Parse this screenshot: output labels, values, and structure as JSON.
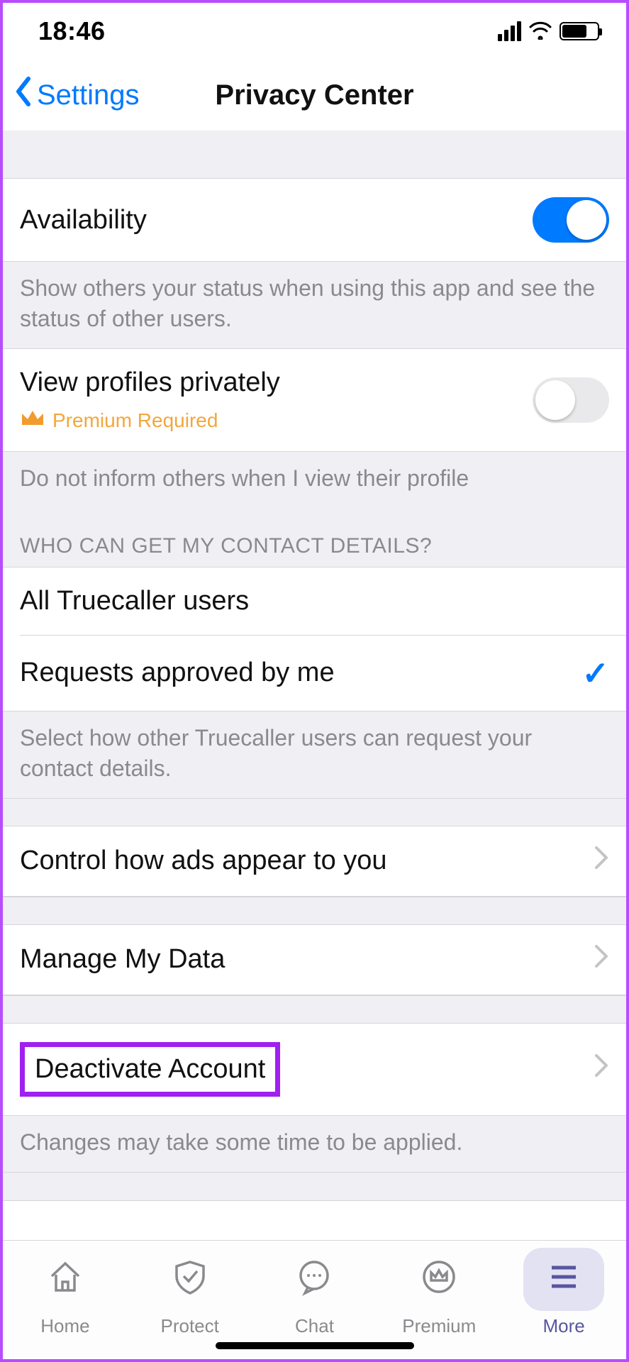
{
  "status": {
    "time": "18:46"
  },
  "nav": {
    "back_label": "Settings",
    "title": "Privacy Center"
  },
  "availability": {
    "label": "Availability",
    "enabled": true,
    "footer": "Show others your status when using this app and see the status of other users."
  },
  "view_privately": {
    "label": "View profiles privately",
    "premium_label": "Premium Required",
    "enabled": false,
    "footer": "Do not inform others when I view their profile"
  },
  "contact_details": {
    "header": "WHO CAN GET MY CONTACT DETAILS?",
    "options": [
      {
        "label": "All Truecaller users",
        "selected": false
      },
      {
        "label": "Requests approved by me",
        "selected": true
      }
    ],
    "footer": "Select how other Truecaller users can request your contact details."
  },
  "ads_row": {
    "label": "Control how ads appear to you"
  },
  "data_row": {
    "label": "Manage My Data"
  },
  "deactivate_row": {
    "label": "Deactivate Account",
    "footer": "Changes may take some time to be applied."
  },
  "tabs": [
    {
      "label": "Home"
    },
    {
      "label": "Protect"
    },
    {
      "label": "Chat"
    },
    {
      "label": "Premium"
    },
    {
      "label": "More"
    }
  ]
}
